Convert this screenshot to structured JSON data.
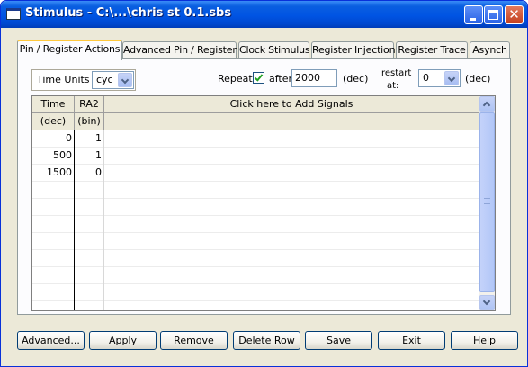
{
  "window": {
    "title": "Stimulus - C:\\...\\chris st 0.1.sbs"
  },
  "tabs": [
    {
      "label": "Pin / Register Actions",
      "active": true
    },
    {
      "label": "Advanced Pin / Register",
      "active": false
    },
    {
      "label": "Clock Stimulus",
      "active": false
    },
    {
      "label": "Register Injection",
      "active": false
    },
    {
      "label": "Register Trace",
      "active": false
    },
    {
      "label": "Asynch",
      "active": false
    }
  ],
  "controls": {
    "time_units_label": "Time Units",
    "time_units_value": "cyc",
    "repeat_label": "Repeat",
    "repeat_checked": true,
    "after_label": "after:",
    "after_value": "2000",
    "after_unit": "(dec)",
    "restart_label_1": "restart",
    "restart_label_2": "at:",
    "restart_value": "0",
    "restart_unit": "(dec)"
  },
  "grid": {
    "columns": [
      {
        "header": "Time",
        "subheader": "(dec)"
      },
      {
        "header": "RA2",
        "subheader": "(bin)"
      },
      {
        "header": "Click here to Add Signals",
        "subheader": ""
      }
    ],
    "rows": [
      {
        "time": "0",
        "ra2": "1"
      },
      {
        "time": "500",
        "ra2": "1"
      },
      {
        "time": "1500",
        "ra2": "0"
      }
    ]
  },
  "buttons": [
    "Advanced...",
    "Apply",
    "Remove",
    "Delete Row",
    "Save",
    "Exit",
    "Help"
  ],
  "colors": {
    "titlebar": "#0054e3",
    "tab_highlight": "#ffc83c",
    "checkbox_tick": "#21a121"
  }
}
